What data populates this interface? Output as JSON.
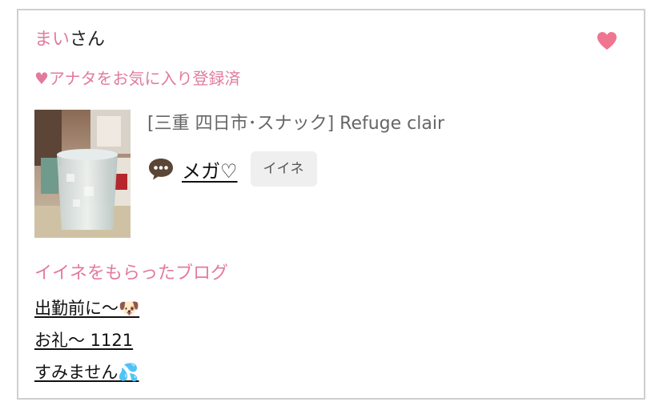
{
  "user": {
    "name": "まい",
    "suffix": "さん"
  },
  "favorite_status": "♥アナタをお気に入り登録済",
  "post": {
    "shop": "[三重 四日市･スナック]  Refuge clair",
    "sender": "メガ♡",
    "like_button_label": "イイネ"
  },
  "blogs": {
    "heading": "イイネをもらったブログ",
    "items": [
      "出勤前に〜🐶",
      "お礼〜 1121",
      "すみません💦"
    ]
  },
  "colors": {
    "accent_pink": "#e27aa0",
    "heart": "#ef7590",
    "border": "#cfcfcf",
    "button_bg": "#efefef"
  },
  "icons": {
    "favorite": "heart-icon",
    "comment": "speech-bubble-icon"
  }
}
